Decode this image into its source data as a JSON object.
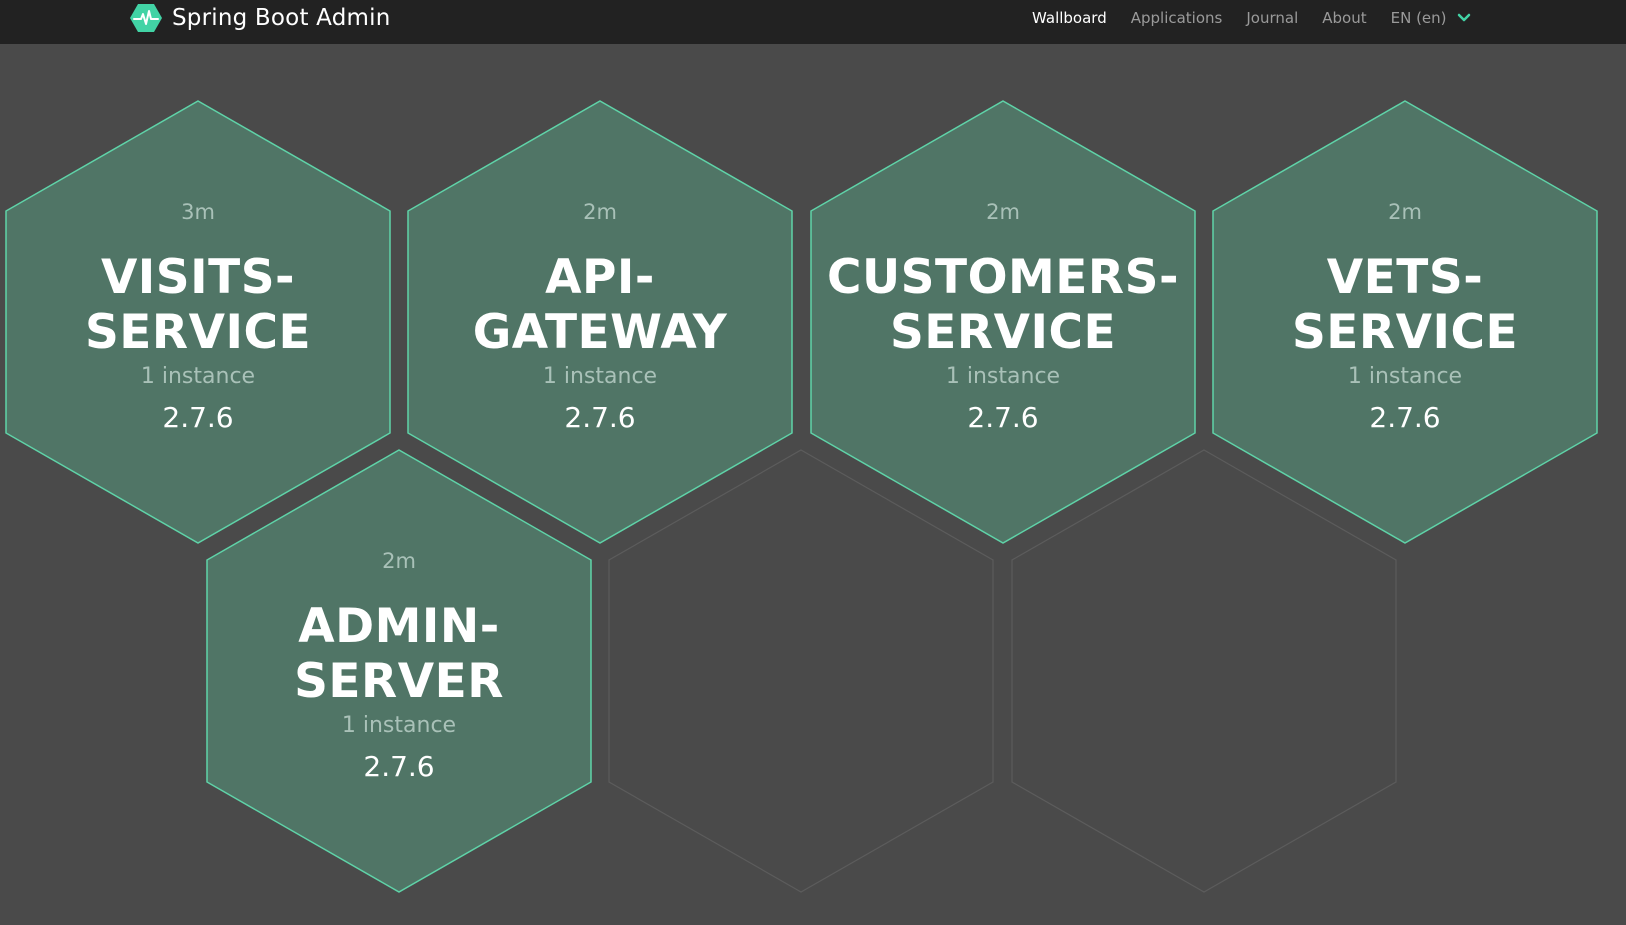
{
  "app": {
    "title": "Spring Boot Admin"
  },
  "nav": {
    "items": [
      {
        "label": "Wallboard",
        "active": true
      },
      {
        "label": "Applications",
        "active": false
      },
      {
        "label": "Journal",
        "active": false
      },
      {
        "label": "About",
        "active": false
      }
    ],
    "language": "EN (en)"
  },
  "colors": {
    "navbar_bg": "#222222",
    "page_bg": "#4a4a4a",
    "hex_fill": "#507566",
    "hex_stroke": "#5fd3a8",
    "empty_hex_stroke": "#5c5c5c",
    "accent": "#42d3a5"
  },
  "applications": [
    {
      "name_line1": "VISITS-",
      "name_line2": "SERVICE",
      "uptime": "3m",
      "instances": "1 instance",
      "version": "2.7.6"
    },
    {
      "name_line1": "API-",
      "name_line2": "GATEWAY",
      "uptime": "2m",
      "instances": "1 instance",
      "version": "2.7.6"
    },
    {
      "name_line1": "CUSTOMERS-",
      "name_line2": "SERVICE",
      "uptime": "2m",
      "instances": "1 instance",
      "version": "2.7.6"
    },
    {
      "name_line1": "VETS-",
      "name_line2": "SERVICE",
      "uptime": "2m",
      "instances": "1 instance",
      "version": "2.7.6"
    },
    {
      "name_line1": "ADMIN-",
      "name_line2": "SERVER",
      "uptime": "2m",
      "instances": "1 instance",
      "version": "2.7.6"
    }
  ]
}
